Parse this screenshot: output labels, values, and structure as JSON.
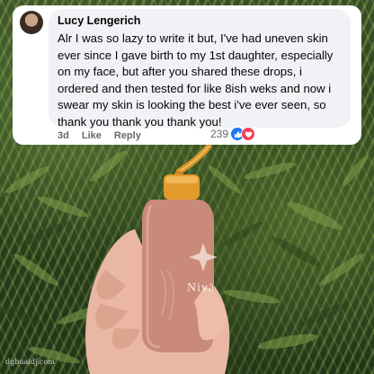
{
  "comment": {
    "author": "Lucy Lengerich",
    "text": "Alr I was so lazy to write it but, I've had uneven skin ever since I gave birth to my 1st daughter, especially on my face, but after you shared these drops, i ordered and then tested for like 8ish weks and now i swear my skin is looking the best i've ever seen, so thank you thank you thank you!",
    "timestamp": "3d",
    "like_label": "Like",
    "reply_label": "Reply",
    "reaction_count": "239",
    "reaction_icons": [
      "like-icon",
      "love-icon"
    ]
  },
  "product": {
    "brand_label": "Nivä"
  },
  "watermark": "dgbuaidj.com",
  "colors": {
    "like_blue": "#1877f2",
    "love_red": "#f33e58",
    "bottle_pink": "#c98a7a",
    "serum_amber": "#e69a2a",
    "bubble_gray": "#f0f2f5"
  }
}
